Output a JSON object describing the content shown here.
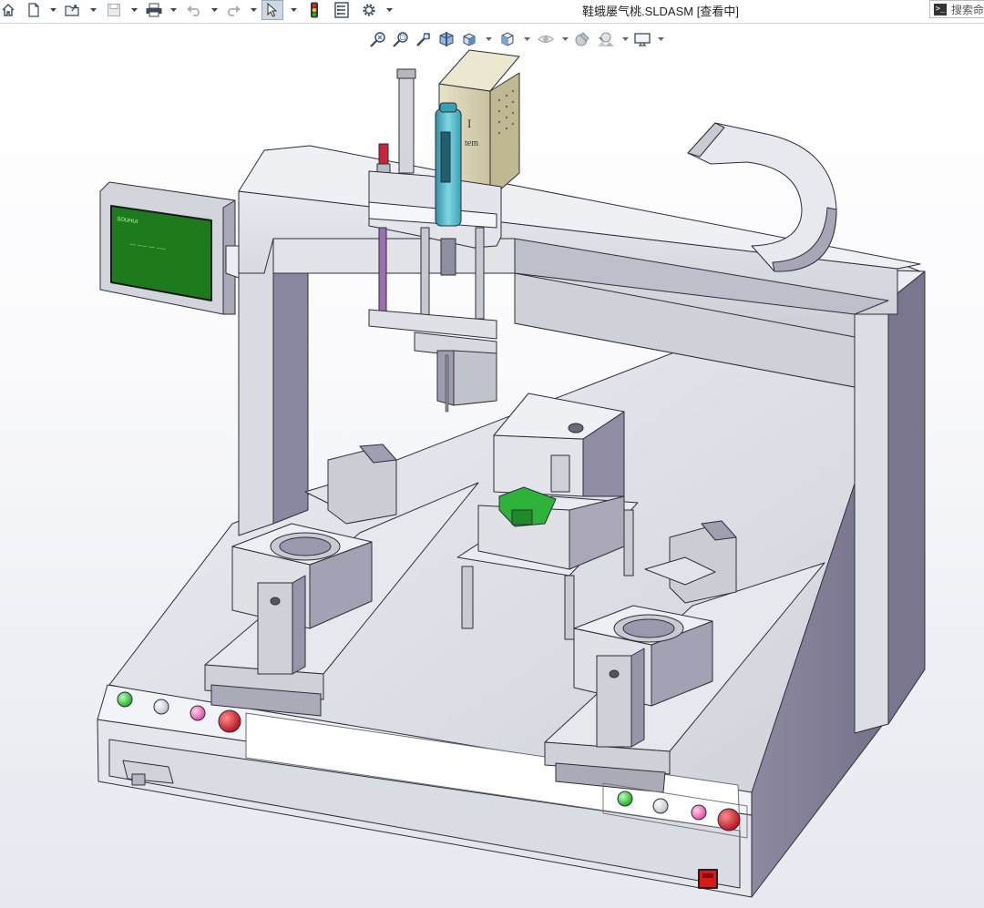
{
  "window": {
    "document_title": "鞋蛾屡气桃.SLDASM [查看中]",
    "search_placeholder": "搜索命",
    "search_icon_glyph": ">_"
  },
  "quick_access": [
    {
      "name": "home-icon"
    },
    {
      "name": "new-document-icon"
    },
    {
      "name": "open-folder-icon"
    },
    {
      "name": "save-icon"
    },
    {
      "name": "print-icon"
    },
    {
      "name": "undo-icon"
    },
    {
      "name": "redo-icon"
    },
    {
      "name": "select-arrow-icon"
    },
    {
      "name": "rebuild-traffic-light-icon"
    },
    {
      "name": "file-properties-icon"
    },
    {
      "name": "options-gear-icon"
    }
  ],
  "heads_up_toolbar": [
    {
      "name": "zoom-to-fit-icon"
    },
    {
      "name": "zoom-to-area-icon"
    },
    {
      "name": "previous-view-icon"
    },
    {
      "name": "section-view-icon"
    },
    {
      "name": "view-orientation-icon"
    },
    {
      "name": "display-style-icon"
    },
    {
      "name": "hide-show-items-icon"
    },
    {
      "name": "edit-appearance-icon"
    },
    {
      "name": "apply-scene-icon"
    },
    {
      "name": "view-settings-monitor-icon"
    }
  ],
  "model": {
    "hmi_screen_caption": "SOUHUI",
    "hmi_screen_text": "~~ ~~~ ~~ ~~~",
    "controller_box_text": "I",
    "controller_box_text2": "tem",
    "colors": {
      "frame_light": "#e2e4ea",
      "frame_mid": "#c9cbd4",
      "frame_dark": "#8f8fa3",
      "frame_shadow": "#6e6b82",
      "hmi_green": "#1d7a1d",
      "syringe_cyan": "#4fb7c8",
      "controller_tan": "#ddd6b4",
      "pcb_green": "#2fb23a",
      "button_red": "#d8202c",
      "button_green": "#2bd62b",
      "button_pink": "#f06fb7",
      "rod_purple": "#9c6fb0",
      "estop_red": "#d81a1a"
    }
  }
}
